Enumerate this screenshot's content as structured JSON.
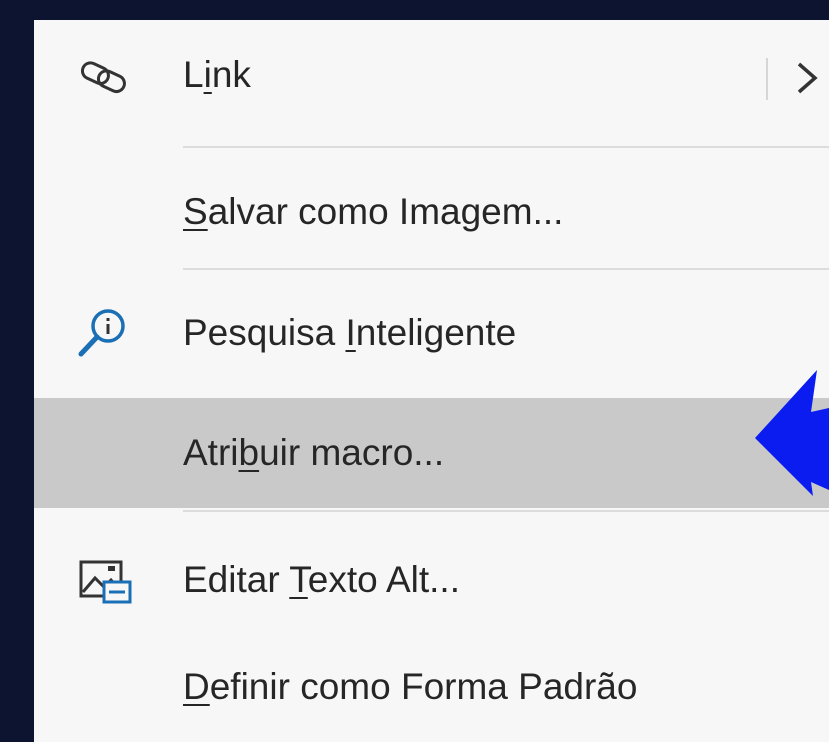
{
  "menu": {
    "items": [
      {
        "name": "link",
        "pre": "L",
        "key": "i",
        "post": "nk",
        "icon": "link-icon",
        "has_submenu": true
      },
      {
        "name": "save-as-image",
        "pre": "",
        "key": "S",
        "post": "alvar como Imagem...",
        "icon": null
      },
      {
        "name": "smart-lookup",
        "pre": "Pesquisa ",
        "key": "I",
        "post": "nteligente",
        "icon": "smart-lookup-icon"
      },
      {
        "name": "assign-macro",
        "pre": "Atri",
        "key": "b",
        "post": "uir macro...",
        "icon": null,
        "highlighted": true
      },
      {
        "name": "edit-alt-text",
        "pre": "Editar ",
        "key": "T",
        "post": "exto Alt...",
        "icon": "alt-text-icon"
      },
      {
        "name": "set-default-shape",
        "pre": "",
        "key": "D",
        "post": "efinir como Forma Padrão",
        "icon": null
      }
    ]
  },
  "colors": {
    "menu_background": "#f7f7f7",
    "highlight": "#c9c9c9",
    "page_background": "#0d1430",
    "annotation_arrow": "#0a1cf0",
    "search_icon": "#1a6fb5"
  },
  "annotation": {
    "icon": "blue-arrow-pointing-left"
  }
}
